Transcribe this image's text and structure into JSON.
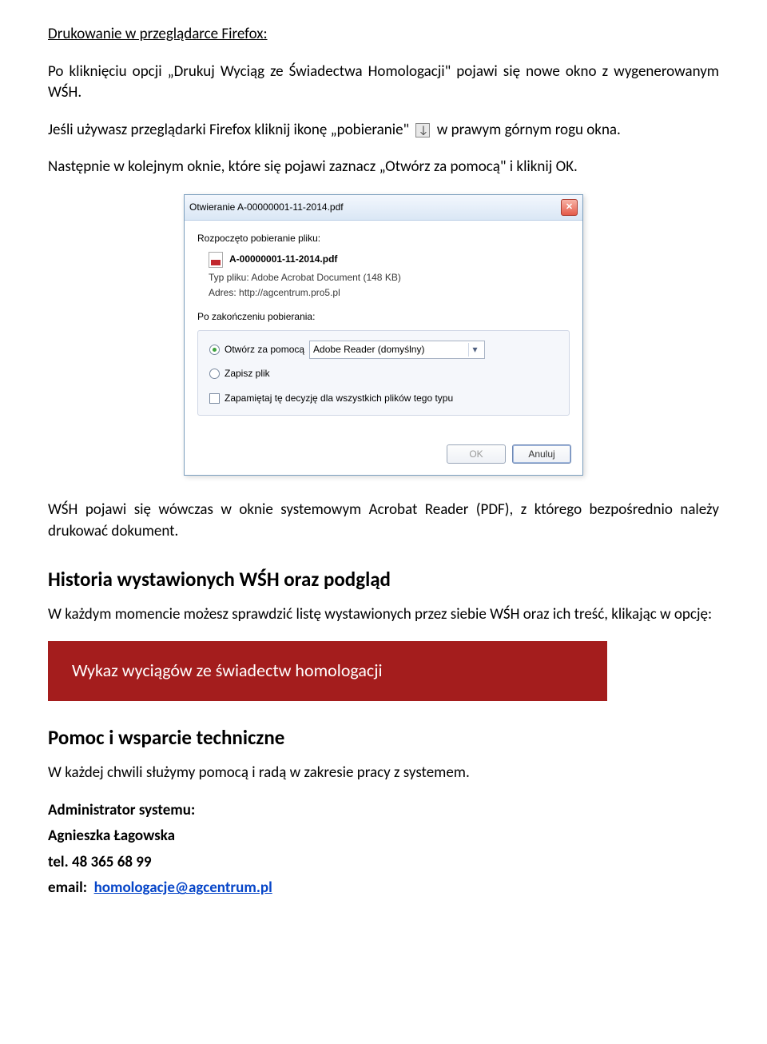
{
  "heading1": "Drukowanie w przeglądarce Firefox:",
  "para1": "Po kliknięciu opcji „Drukuj Wyciąg ze Świadectwa Homologacji\" pojawi się nowe okno z wygenerowanym WŚH.",
  "para2_a": "Jeśli używasz przeglądarki Firefox kliknij ikonę „pobieranie\"",
  "para2_b": "w prawym górnym rogu okna.",
  "para3": "Następnie w kolejnym oknie, które się pojawi zaznacz „Otwórz za pomocą\" i kliknij OK.",
  "dialog": {
    "title": "Otwieranie A-00000001-11-2014.pdf",
    "startLabel": "Rozpoczęto pobieranie pliku:",
    "fileName": "A-00000001-11-2014.pdf",
    "typeLabel": "Typ pliku:",
    "typeValue": "Adobe Acrobat Document (148 KB)",
    "addrLabel": "Adres:",
    "addrValue": "http://agcentrum.pro5.pl",
    "afterLabel": "Po zakończeniu pobierania:",
    "openWith": "Otwórz za pomocą",
    "openApp": "Adobe Reader  (domyślny)",
    "save": "Zapisz plik",
    "remember": "Zapamiętaj tę decyzję dla wszystkich plików tego typu",
    "ok": "OK",
    "cancel": "Anuluj"
  },
  "para4": "WŚH pojawi się wówczas w oknie systemowym Acrobat Reader (PDF), z którego bezpośrednio należy drukować dokument.",
  "heading2": "Historia wystawionych WŚH oraz podgląd",
  "para5": "W każdym momencie możesz sprawdzić listę wystawionych przez  siebie WŚH oraz ich treść, klikając w opcję:",
  "redButton": "Wykaz wyciągów ze świadectw homologacji",
  "heading3": "Pomoc i wsparcie techniczne",
  "para6": "W każdej chwili służymy pomocą i radą w zakresie pracy z systemem.",
  "contact": {
    "adminLabel": "Administrator systemu:",
    "name": "Agnieszka Łagowska",
    "telLabel": "tel.",
    "tel": "48 365 68 99",
    "emailLabel": "email:",
    "email": "homologacje@agcentrum.pl"
  }
}
